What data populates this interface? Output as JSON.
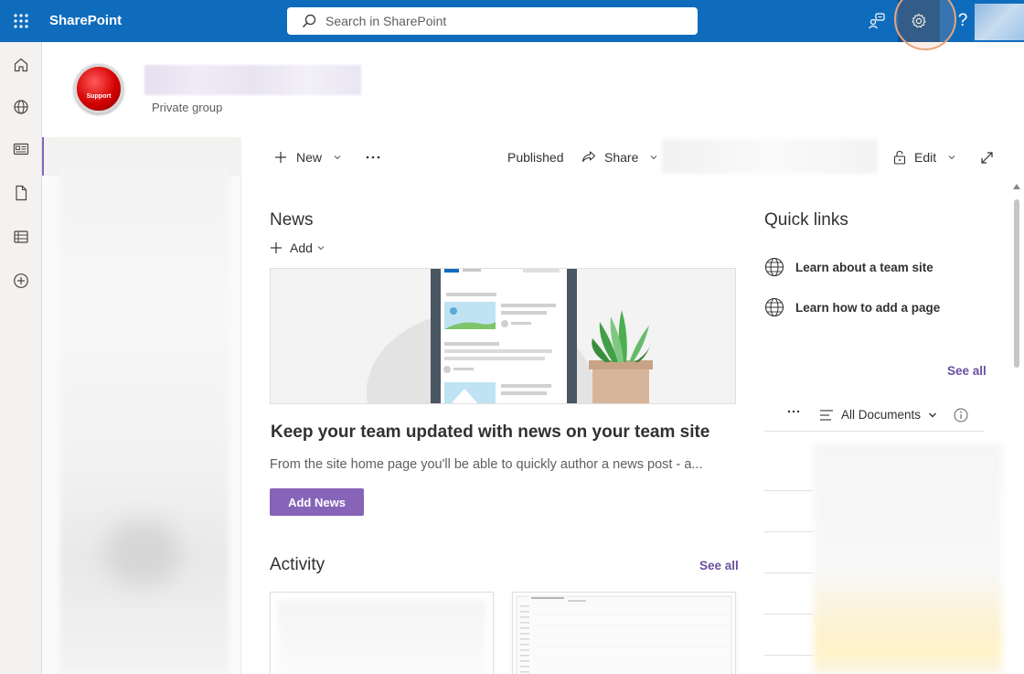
{
  "suitebar": {
    "brand": "SharePoint",
    "search_placeholder": "Search in SharePoint",
    "help_label": "?"
  },
  "site": {
    "logo_text": "Support",
    "subtitle": "Private group"
  },
  "commandbar": {
    "new_label": "New",
    "published_label": "Published",
    "share_label": "Share",
    "edit_label": "Edit"
  },
  "news": {
    "title": "News",
    "add_label": "Add",
    "heading": "Keep your team updated with news on your team site",
    "description": "From the site home page you'll be able to quickly author a news post - a...",
    "button_label": "Add News"
  },
  "activity": {
    "title": "Activity",
    "see_all": "See all"
  },
  "quick_links": {
    "title": "Quick links",
    "items": [
      {
        "label": "Learn about a team site"
      },
      {
        "label": "Learn how to add a page"
      }
    ],
    "see_all": "See all"
  },
  "documents": {
    "view_label": "All Documents"
  },
  "colors": {
    "suitebar": "#0f6cbd",
    "accent": "#8764b8"
  },
  "icons": {
    "rail": [
      "home-icon",
      "globe-icon",
      "news-icon",
      "document-icon",
      "list-icon",
      "add-circle-icon"
    ]
  }
}
